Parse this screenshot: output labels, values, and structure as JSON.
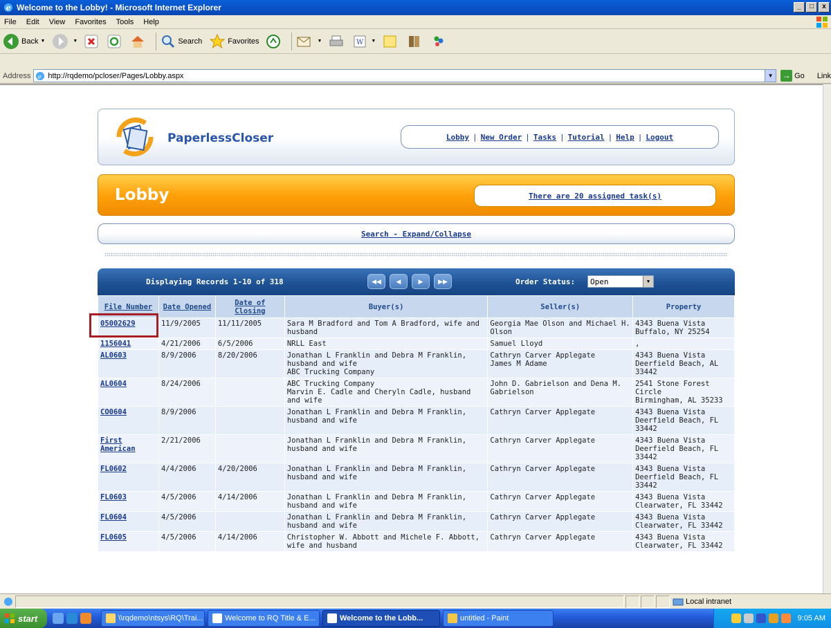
{
  "window": {
    "title": "Welcome to the Lobby! - Microsoft Internet Explorer",
    "buttons": [
      "_",
      "□",
      "x"
    ]
  },
  "menu": [
    "File",
    "Edit",
    "View",
    "Favorites",
    "Tools",
    "Help"
  ],
  "toolbar": {
    "back_label": "Back",
    "search_label": "Search",
    "favorites_label": "Favorites"
  },
  "address": {
    "label": "Address",
    "url": "http://rqdemo/pcloser/Pages/Lobby.aspx",
    "go_label": "Go",
    "links_label": "Link"
  },
  "app": {
    "brand": "PaperlessCloser",
    "nav": [
      "Lobby",
      "New Order",
      "Tasks",
      "Tutorial",
      "Help",
      "Logout"
    ],
    "nav_sep": "|",
    "page_title": "Lobby",
    "tasks_link": "There are 20 assigned task(s)",
    "search_link": "Search - Expand/Collapse"
  },
  "grid": {
    "records_info": "Displaying Records 1-10 of 318",
    "order_status_label": "Order Status:",
    "order_status_value": "Open",
    "pager": [
      "first",
      "previous",
      "next",
      "last"
    ],
    "columns": [
      "File Number",
      "Date Opened",
      "Date of Closing",
      "Buyer(s)",
      "Seller(s)",
      "Property"
    ],
    "rows": [
      {
        "file": "05002629",
        "opened": "11/9/2005",
        "closing": "11/11/2005",
        "buyers": "Sara M Bradford and Tom A Bradford, wife and husband",
        "sellers": "Georgia Mae Olson and Michael H. Olson",
        "property": "4343 Buena Vista Buffalo, NY 25254"
      },
      {
        "file": "1156041",
        "opened": "4/21/2006",
        "closing": "6/5/2006",
        "buyers": "NRLL East",
        "sellers": "Samuel Lloyd",
        "property": ","
      },
      {
        "file": "AL0603",
        "opened": "8/9/2006",
        "closing": "8/20/2006",
        "buyers": "Jonathan L Franklin and Debra M Franklin, husband and wife\nABC Trucking Company",
        "sellers": "Cathryn Carver Applegate\nJames M Adame",
        "property": "4343 Buena Vista Deerfield Beach, AL 33442"
      },
      {
        "file": "AL0604",
        "opened": "8/24/2006",
        "closing": "",
        "buyers": "ABC Trucking Company\nMarvin E. Cadle and Cheryln Cadle, husband and wife",
        "sellers": "John D. Gabrielson and Dena M. Gabrielson",
        "property": "2541 Stone Forest Circle\nBirmingham, AL 35233"
      },
      {
        "file": "CO0604",
        "opened": "8/9/2006",
        "closing": "",
        "buyers": "Jonathan L Franklin and Debra M Franklin, husband and wife",
        "sellers": "Cathryn Carver Applegate",
        "property": "4343 Buena Vista Deerfield Beach, FL 33442"
      },
      {
        "file": "First American",
        "opened": "2/21/2006",
        "closing": "",
        "buyers": "Jonathan L Franklin and Debra M Franklin, husband and wife",
        "sellers": "Cathryn Carver Applegate",
        "property": "4343 Buena Vista Deerfield Beach, FL 33442"
      },
      {
        "file": "FL0602",
        "opened": "4/4/2006",
        "closing": "4/20/2006",
        "buyers": "Jonathan L Franklin and Debra M Franklin, husband and wife",
        "sellers": "Cathryn Carver Applegate",
        "property": "4343 Buena Vista Deerfield Beach, FL 33442"
      },
      {
        "file": "FL0603",
        "opened": "4/5/2006",
        "closing": "4/14/2006",
        "buyers": "Jonathan L Franklin and Debra M Franklin, husband and wife",
        "sellers": "Cathryn Carver Applegate",
        "property": "4343 Buena Vista Clearwater, FL 33442"
      },
      {
        "file": "FL0604",
        "opened": "4/5/2006",
        "closing": "",
        "buyers": "Jonathan L Franklin and Debra M Franklin, husband and wife",
        "sellers": "Cathryn Carver Applegate",
        "property": "4343 Buena Vista Clearwater, FL 33442"
      },
      {
        "file": "FL0605",
        "opened": "4/5/2006",
        "closing": "4/14/2006",
        "buyers": "Christopher W. Abbott and Michele F. Abbott, wife and husband",
        "sellers": "Cathryn Carver Applegate",
        "property": "4343 Buena Vista Clearwater, FL 33442"
      }
    ]
  },
  "statusbar": {
    "zone": "Local intranet"
  },
  "taskbar": {
    "start": "start",
    "tasks": [
      {
        "label": "\\\\rqdemo\\ntsys\\RQ\\Trai...",
        "active": false
      },
      {
        "label": "Welcome to RQ Title & E...",
        "active": false
      },
      {
        "label": "Welcome to the Lobb...",
        "active": true
      },
      {
        "label": "untitled - Paint",
        "active": false
      }
    ],
    "clock": "9:05 AM"
  },
  "colors": {
    "brand_blue": "#2956a8",
    "lobby_orange": "#ffa20a",
    "grid_header": "#1e5295",
    "highlight_red": "#a81e24"
  }
}
